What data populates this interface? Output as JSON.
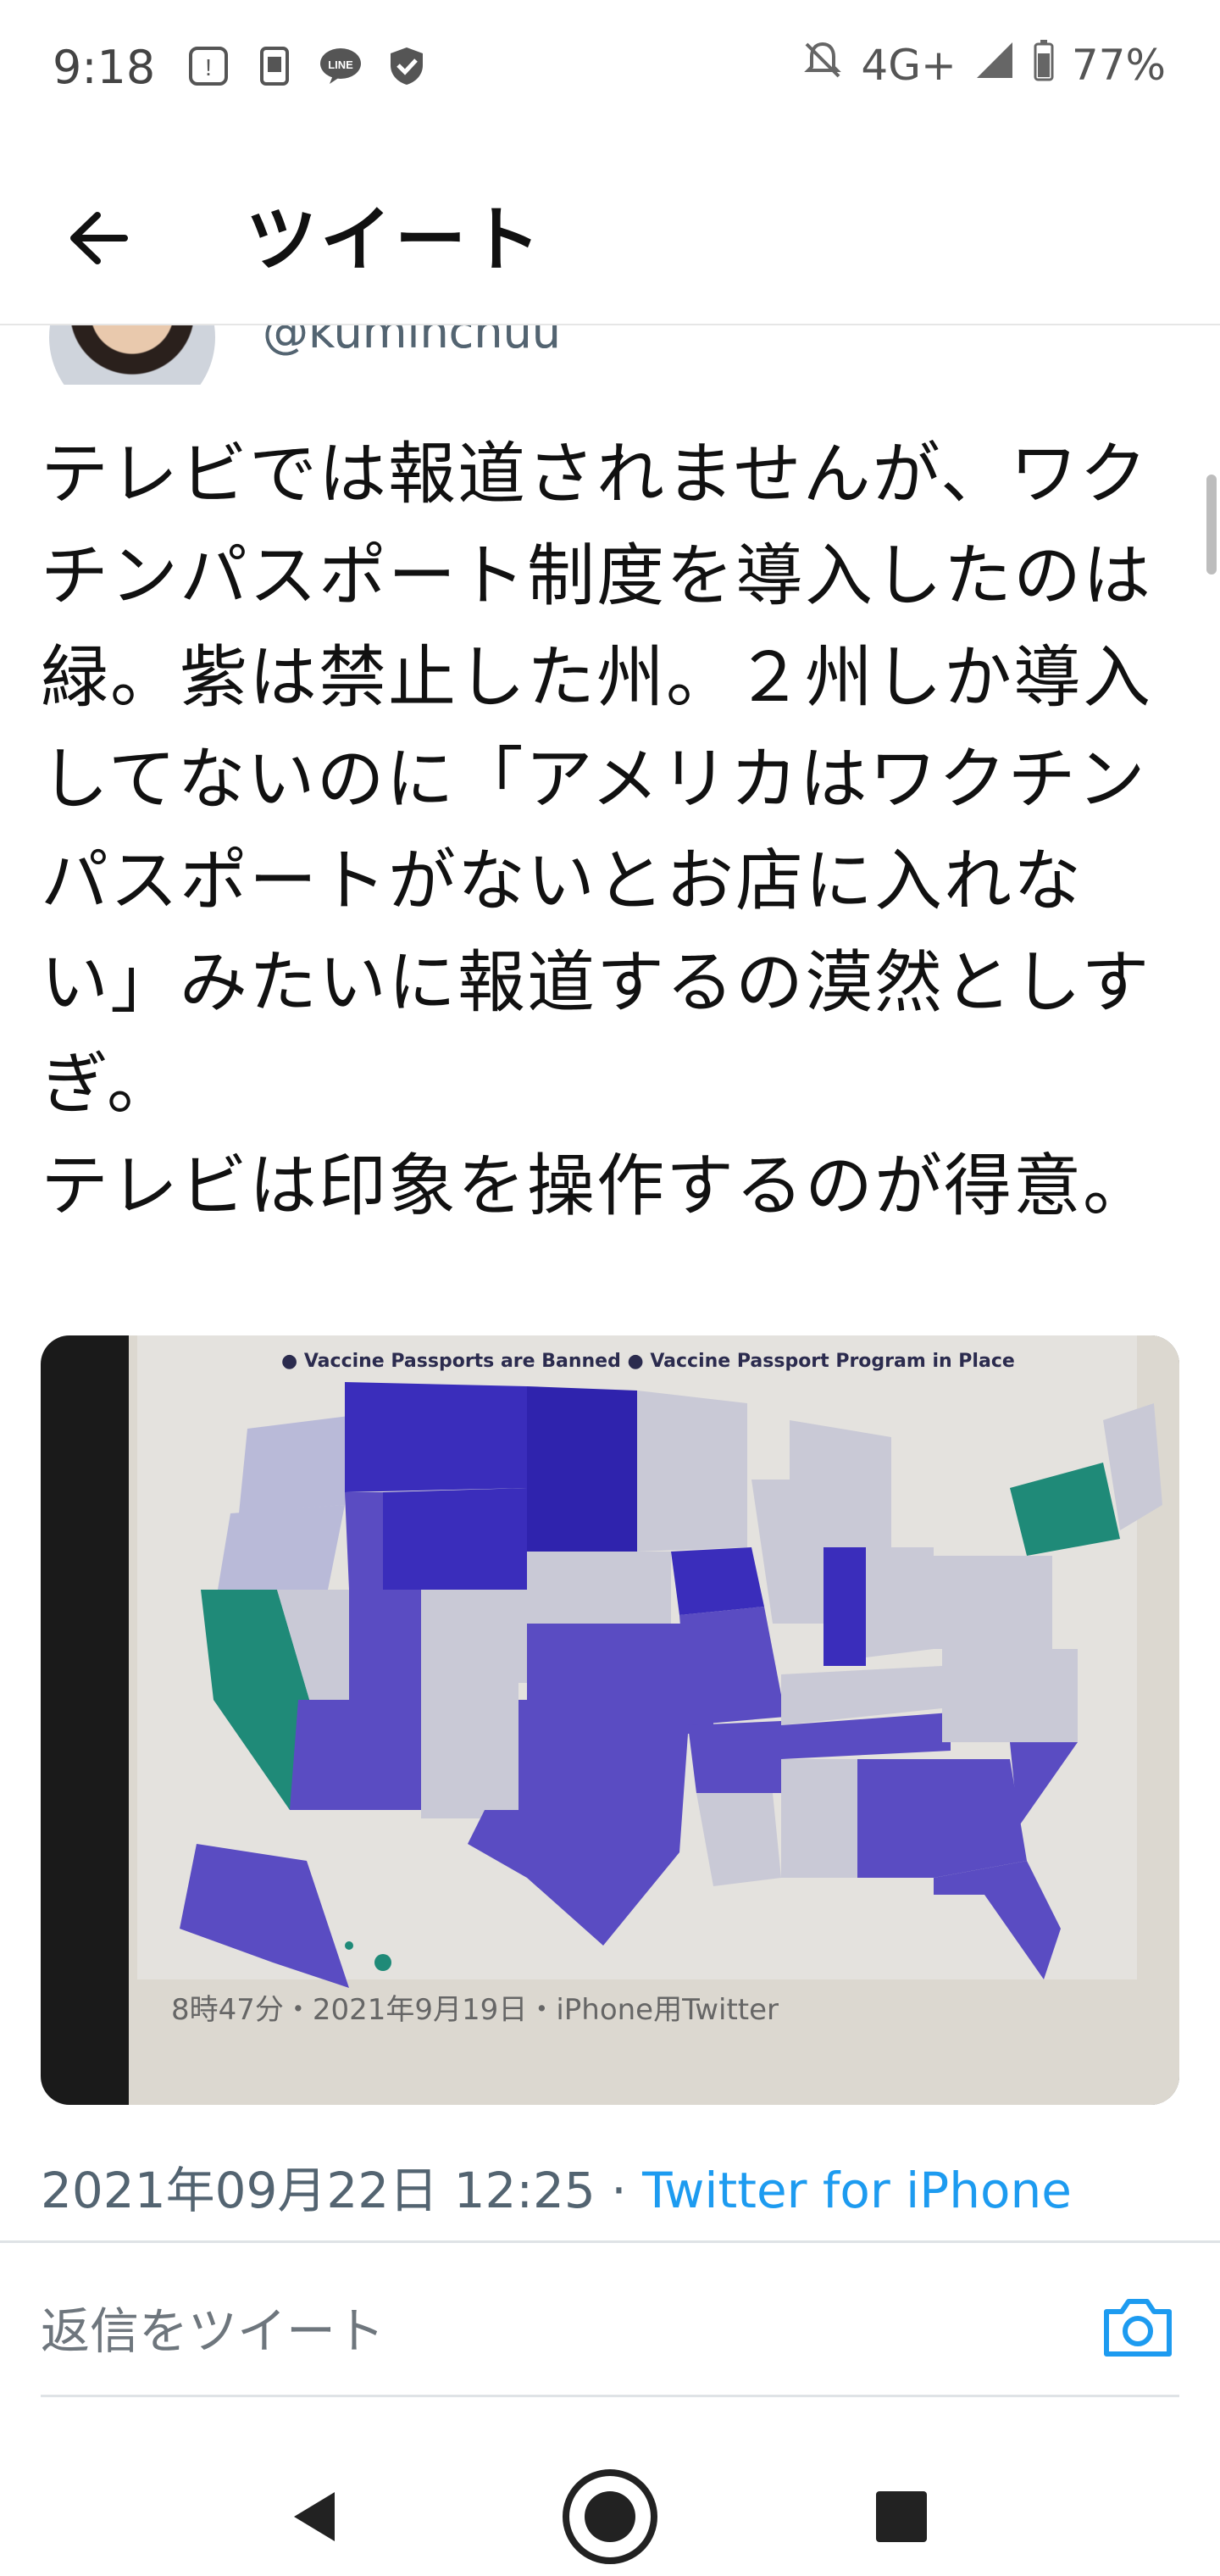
{
  "status_bar": {
    "time": "9:18",
    "network": "4G+",
    "battery": "77%",
    "icons": [
      "notification-icon",
      "sim-icon",
      "line-app-icon",
      "shield-check-icon",
      "mute-bell-icon",
      "signal-icon",
      "battery-icon"
    ]
  },
  "header": {
    "title": "ツイート",
    "back_icon": "back-arrow-icon"
  },
  "tweet": {
    "handle": "@kuminchuu",
    "text": "テレビでは報道されませんが、ワクチンパスポート制度を導入したのは緑。紫は禁止した州。２州しか導入してないのに「アメリカはワクチンパスポートがないとお店に入れない」みたいに報道するの漠然としすぎ。\nテレビは印象を操作するのが得意。",
    "media": {
      "legend": "● Vaccine Passports are Banned  ● Vaccine Passport Program in Place",
      "caption": "8時47分・2021年9月19日・iPhone用Twitter",
      "colors": {
        "banned": "#5a4cc2",
        "program": "#1f8a78",
        "neutral": "#c9c9d6"
      }
    },
    "timestamp": "2021年09月22日 12:25",
    "separator": " · ",
    "source": "Twitter for iPhone"
  },
  "reply": {
    "placeholder": "返信をツイート",
    "camera_icon": "camera-icon"
  },
  "nav": {
    "back_icon": "nav-back-icon",
    "home_icon": "nav-home-icon",
    "recents_icon": "nav-recents-icon"
  }
}
